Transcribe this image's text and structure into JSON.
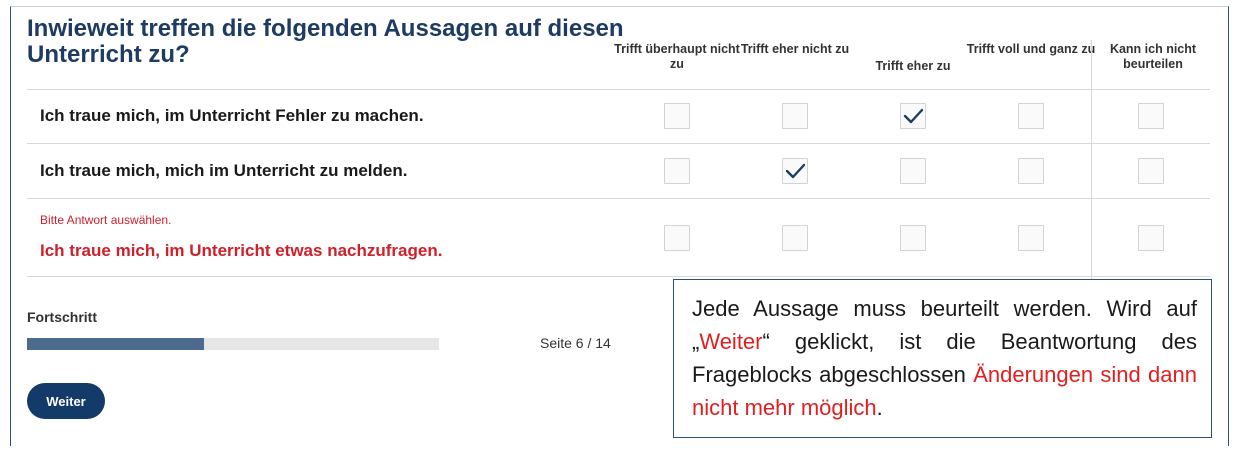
{
  "question": {
    "title": "Inwieweit treffen die folgenden Aussagen auf diesen Unterricht zu?"
  },
  "columns": [
    {
      "label": "Trifft überhaupt nicht zu"
    },
    {
      "label": "Trifft eher nicht zu"
    },
    {
      "label": "Trifft eher zu"
    },
    {
      "label": "Trifft voll und ganz zu"
    },
    {
      "label": "Kann ich nicht beurteilen"
    }
  ],
  "rows": [
    {
      "statement": "Ich traue mich, im Unterricht Fehler zu machen.",
      "selected_column": 3,
      "error": false
    },
    {
      "statement": "Ich traue mich, mich im Unterricht zu melden.",
      "selected_column": 2,
      "error": false
    },
    {
      "statement": "Ich traue mich, im Unterricht etwas nachzufragen.",
      "selected_column": null,
      "error": true
    }
  ],
  "error_message": "Bitte Antwort auswählen.",
  "progress": {
    "label": "Fortschritt",
    "fraction": 0.43,
    "page_indicator": "Seite 6 / 14"
  },
  "buttons": {
    "next_label": "Weiter"
  },
  "annotation": {
    "part1": "Jede Aussage muss beurteilt werden. Wird auf „",
    "weiter": "Weiter",
    "part2": "“ geklickt, ist die Beantwortung des Frageblocks abgeschlossen ",
    "warning": "Änderungen sind dann nicht mehr möglich",
    "part3": "."
  },
  "colors": {
    "title": "#1d3b63",
    "error": "#d0202a",
    "check": "#1d3b63",
    "button": "#133a69",
    "progress_fill": "#4c6a8e"
  }
}
